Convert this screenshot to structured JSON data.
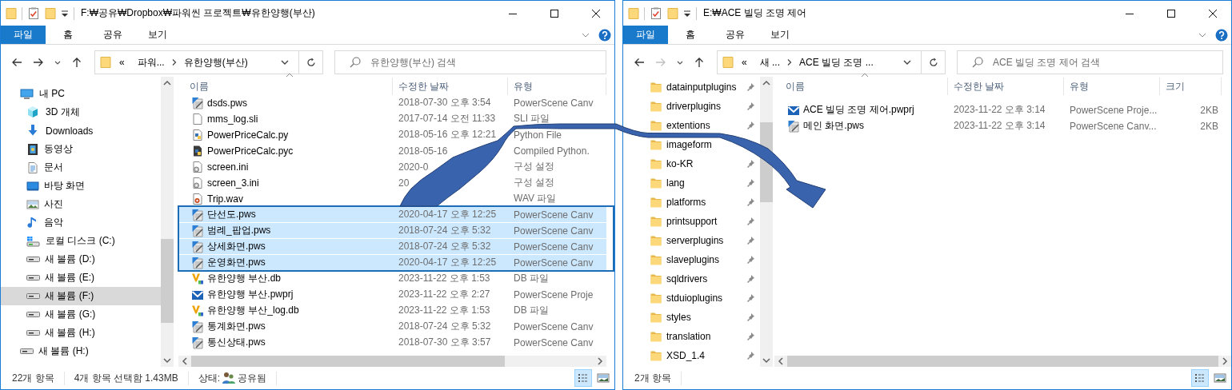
{
  "windows": [
    {
      "title": "F:₩공유₩Dropbox₩파워씬 프로젝트₩유한양행(부산)",
      "ribbon_tabs": [
        {
          "label": "파일",
          "selected": true
        },
        {
          "label": "홈",
          "selected": false
        },
        {
          "label": "공유",
          "selected": false
        },
        {
          "label": "보기",
          "selected": false
        }
      ],
      "forward_enabled": true,
      "address": {
        "overflow_mark": "«",
        "segments": [
          "파워...",
          "유한양행(부산)"
        ]
      },
      "search": {
        "placeholder": "유한양행(부산) 검색"
      },
      "nav": [
        {
          "label": "내 PC",
          "kind": "pc",
          "selected": false,
          "children": [
            {
              "label": "3D 개체",
              "kind": "cube",
              "selected": false
            },
            {
              "label": "Downloads",
              "kind": "download",
              "selected": false
            },
            {
              "label": "동영상",
              "kind": "video",
              "selected": false
            },
            {
              "label": "문서",
              "kind": "document",
              "selected": false
            },
            {
              "label": "바탕 화면",
              "kind": "desktop",
              "selected": false
            },
            {
              "label": "사진",
              "kind": "picture",
              "selected": false
            },
            {
              "label": "음악",
              "kind": "music",
              "selected": false
            },
            {
              "label": "로컬 디스크 (C:)",
              "kind": "local_disk",
              "selected": false
            },
            {
              "label": "새 볼륨 (D:)",
              "kind": "drive",
              "selected": false
            },
            {
              "label": "새 볼륨 (E:)",
              "kind": "drive",
              "selected": false
            },
            {
              "label": "새 볼륨 (F:)",
              "kind": "drive",
              "selected": true
            },
            {
              "label": "새 볼륨 (G:)",
              "kind": "drive",
              "selected": false
            },
            {
              "label": "새 볼륨 (H:)",
              "kind": "drive",
              "selected": false
            }
          ]
        },
        {
          "label": "새 볼륨 (H:)",
          "kind": "drive",
          "selected": false
        }
      ],
      "file_list": {
        "columns": [
          {
            "label": "이름",
            "kind": "name",
            "sorted": true
          },
          {
            "label": "수정한 날짜",
            "kind": "date",
            "sorted": false
          },
          {
            "label": "유형",
            "kind": "type",
            "sorted": false
          }
        ],
        "rows": [
          {
            "name": "dsds.pws",
            "kind": "pws",
            "date": "2018-07-30 오후 3:54",
            "type": "PowerScene Canv",
            "selected": false
          },
          {
            "name": "mms_log.sli",
            "kind": "blank",
            "date": "2017-07-14 오전 11:33",
            "type": "SLI 파일",
            "selected": false
          },
          {
            "name": "PowerPriceCalc.py",
            "kind": "py",
            "date": "2018-05-16 오후 12:21",
            "type": "Python File",
            "selected": false
          },
          {
            "name": "PowerPriceCalc.pyc",
            "kind": "pyc",
            "date": "2018-05-16",
            "type": "Compiled Python.",
            "selected": false
          },
          {
            "name": "screen.ini",
            "kind": "ini",
            "date": "2020-0",
            "type": "구성 설정",
            "selected": false
          },
          {
            "name": "screen_3.ini",
            "kind": "ini",
            "date": "20",
            "type": "구성 설정",
            "selected": false
          },
          {
            "name": "Trip.wav",
            "kind": "wav",
            "type": "WAV 파일",
            "selected": false
          },
          {
            "name": "단선도.pws",
            "kind": "pws",
            "date": "2020-04-17 오후 12:25",
            "type": "PowerScene Canv",
            "selected": true
          },
          {
            "name": "범례_팝업.pws",
            "kind": "pws",
            "date": "2018-07-24 오후 5:32",
            "type": "PowerScene Canv",
            "selected": true
          },
          {
            "name": "상세화면.pws",
            "kind": "pws",
            "date": "2018-07-24 오후 5:32",
            "type": "PowerScene Canv",
            "selected": true
          },
          {
            "name": "운영화면.pws",
            "kind": "pws",
            "date": "2020-04-17 오후 12:25",
            "type": "PowerScene Canv",
            "selected": true
          },
          {
            "name": "유한양행 부산.db",
            "kind": "db",
            "date": "2023-11-22 오후 1:53",
            "type": "DB 파일",
            "selected": false
          },
          {
            "name": "유한양행 부산.pwprj",
            "kind": "pwprj",
            "date": "2023-11-22 오후 2:27",
            "type": "PowerScene Proje",
            "selected": false
          },
          {
            "name": "유한양행 부산_log.db",
            "kind": "db",
            "date": "2023-11-22 오후 1:53",
            "type": "DB 파일",
            "selected": false
          },
          {
            "name": "통계화면.pws",
            "kind": "pws",
            "date": "2018-07-24 오후 5:32",
            "type": "PowerScene Canv",
            "selected": false
          },
          {
            "name": "통신상태.pws",
            "kind": "pws",
            "date": "2018-07-30 오후 3:57",
            "type": "PowerScene Canv",
            "selected": false
          }
        ]
      },
      "status_bar": {
        "item_count": "22개 항목",
        "selection": "4개 항목 선택함 1.43MB",
        "state_label": "상태:",
        "state_value": "공유됨"
      },
      "view_buttons": [
        {
          "kind": "details",
          "selected": true
        },
        {
          "kind": "preview",
          "selected": false
        }
      ]
    },
    {
      "title": "E:₩ACE 빌딩 조명 제어",
      "ribbon_tabs": [
        {
          "label": "파일",
          "selected": true
        },
        {
          "label": "홈",
          "selected": false
        },
        {
          "label": "공유",
          "selected": false
        },
        {
          "label": "보기",
          "selected": false
        }
      ],
      "forward_enabled": false,
      "address": {
        "overflow_mark": "«",
        "segments": [
          "새 ...",
          "ACE 빌딩 조명 ..."
        ]
      },
      "search": {
        "placeholder": "ACE 빌딩 조명 제어 검색"
      },
      "nav": [
        {
          "label": "datainputplugins",
          "kind": "folder",
          "pinned": true,
          "selected": false
        },
        {
          "label": "driverplugins",
          "kind": "folder",
          "pinned": true,
          "selected": false
        },
        {
          "label": "extentions",
          "kind": "folder",
          "pinned": true,
          "selected": false
        },
        {
          "label": "imageform",
          "kind": "folder",
          "pinned": false,
          "selected": false
        },
        {
          "label": "ko-KR",
          "kind": "folder",
          "pinned": true,
          "selected": false
        },
        {
          "label": "lang",
          "kind": "folder",
          "pinned": true,
          "selected": false
        },
        {
          "label": "platforms",
          "kind": "folder",
          "pinned": true,
          "selected": false
        },
        {
          "label": "printsupport",
          "kind": "folder",
          "pinned": true,
          "selected": false
        },
        {
          "label": "serverplugins",
          "kind": "folder",
          "pinned": true,
          "selected": false
        },
        {
          "label": "slaveplugins",
          "kind": "folder",
          "pinned": true,
          "selected": false
        },
        {
          "label": "sqldrivers",
          "kind": "folder",
          "pinned": true,
          "selected": false
        },
        {
          "label": "stduioplugins",
          "kind": "folder",
          "pinned": true,
          "selected": false
        },
        {
          "label": "styles",
          "kind": "folder",
          "pinned": true,
          "selected": false
        },
        {
          "label": "translation",
          "kind": "folder",
          "pinned": true,
          "selected": false
        },
        {
          "label": "XSD_1.4",
          "kind": "folder",
          "pinned": true,
          "selected": false
        }
      ],
      "file_list": {
        "columns": [
          {
            "label": "이름",
            "kind": "name",
            "sorted": true
          },
          {
            "label": "수정한 날짜",
            "kind": "date",
            "sorted": false
          },
          {
            "label": "유형",
            "kind": "type",
            "sorted": false
          },
          {
            "label": "크기",
            "kind": "size",
            "sorted": false
          }
        ],
        "rows": [
          {
            "name": "ACE 빌딩 조명 제어.pwprj",
            "kind": "pwprj",
            "date": "2023-11-22 오후 3:14",
            "type": "PowerScene Proje...",
            "size": "2KB",
            "selected": false
          },
          {
            "name": "메인 화면.pws",
            "kind": "pws",
            "date": "2023-11-22 오후 3:14",
            "type": "PowerScene Canv...",
            "size": "2KB",
            "selected": false
          }
        ]
      },
      "status_bar": {
        "item_count": "2개 항목"
      },
      "view_buttons": [
        {
          "kind": "details",
          "selected": true
        },
        {
          "kind": "preview",
          "selected": false
        }
      ]
    }
  ]
}
